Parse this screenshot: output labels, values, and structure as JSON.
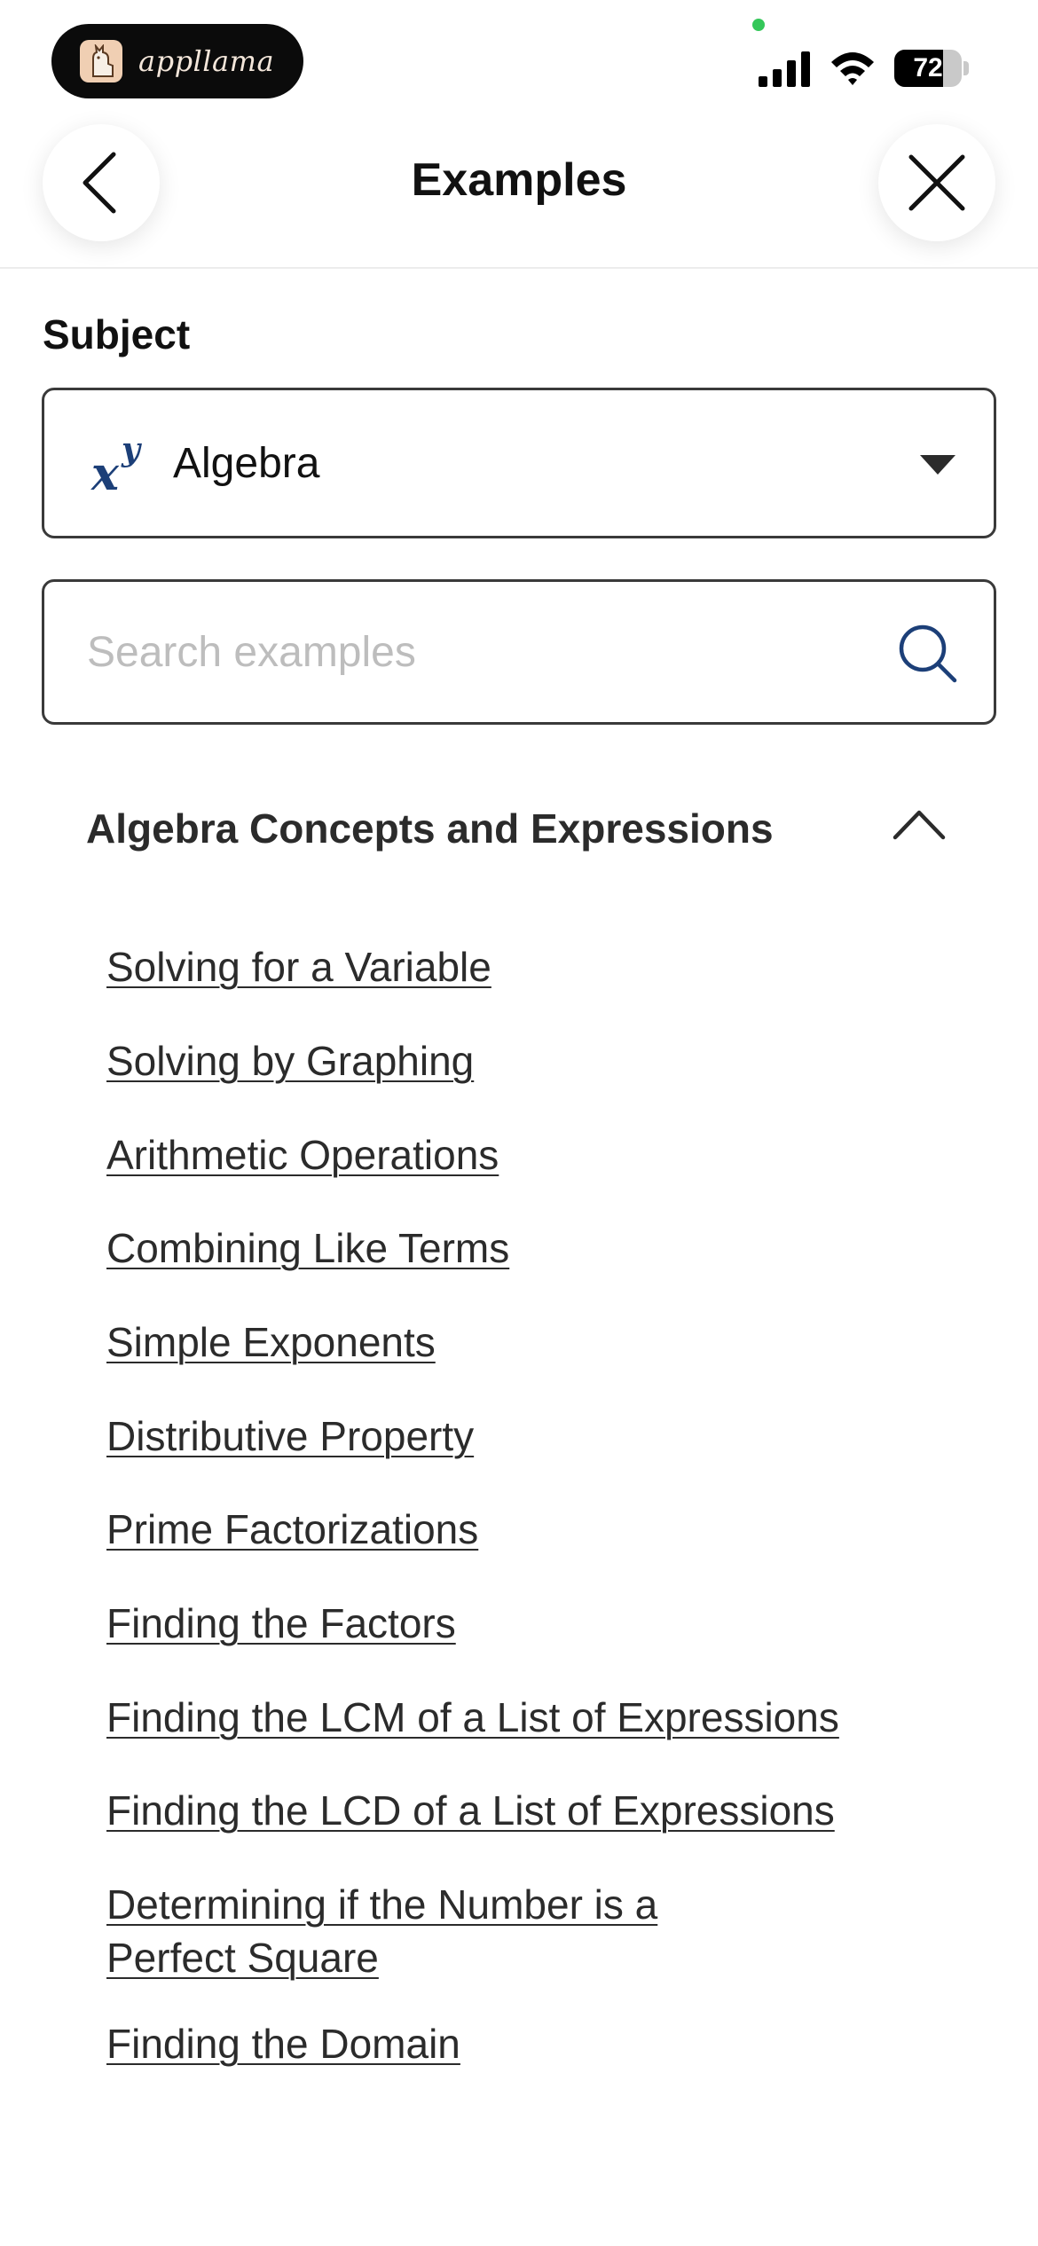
{
  "status_bar": {
    "app_name": "appllama",
    "battery_level": "72",
    "battery_fraction": 0.72
  },
  "header": {
    "title": "Examples",
    "back_icon": "chevron-left-icon",
    "close_icon": "close-icon"
  },
  "subject": {
    "label": "Subject",
    "icon_base": "x",
    "icon_exp": "y",
    "value": "Algebra"
  },
  "search": {
    "placeholder": "Search examples",
    "value": ""
  },
  "section": {
    "title": "Algebra Concepts and Expressions",
    "items": [
      {
        "label": "Solving for a Variable"
      },
      {
        "label": "Solving by Graphing"
      },
      {
        "label": "Arithmetic Operations"
      },
      {
        "label": "Combining Like Terms"
      },
      {
        "label": "Simple Exponents"
      },
      {
        "label": "Distributive Property"
      },
      {
        "label": "Prime Factorizations"
      },
      {
        "label": "Finding the Factors"
      },
      {
        "label": "Finding the LCM of a List of Expressions"
      },
      {
        "label": "Finding the LCD of a List of Expressions"
      },
      {
        "label": "Determining if the Number is a Perfect Square"
      },
      {
        "label": "Finding the Domain"
      }
    ]
  },
  "colors": {
    "accent": "#1c3f78",
    "text": "#2b2b2b",
    "border": "#3a3a3a",
    "placeholder": "#bdbdbd",
    "status_dot": "#34c759"
  }
}
